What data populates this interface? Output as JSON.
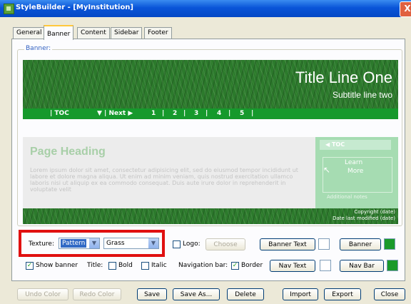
{
  "window": {
    "title": "StyleBuilder - [MyInstitution]",
    "close": "X"
  },
  "tabs": [
    "General",
    "Banner",
    "Content",
    "Sidebar",
    "Footer"
  ],
  "banner_group_label": "Banner:",
  "preview": {
    "title_line_one": "Title Line One",
    "subtitle": "Subtitle line two",
    "nav": [
      "| TOC",
      "▼ | Next ▶",
      "1",
      "|",
      "2",
      "|",
      "3",
      "|",
      "4",
      "|",
      "5",
      "|"
    ],
    "page_heading": "Page Heading",
    "body_text": "Lorem ipsum dolor sit amet, consectetur adipisicing elit, sed do eiusmod tempor incididunt ut labore et dolore magna aliqua. Ut enim ad minim veniam, quis nostrud exercitation ullamco laboris nisi ut aliquip ex ea commodo consequat. Duis aute irure dolor in reprehenderit in voluptate velit",
    "sidebar_head": "◀     TOC",
    "sidebar_learn": "Learn",
    "sidebar_more": "More",
    "sidebar_note": "Additional notes",
    "footer_copyright": "Copyright (date)",
    "footer_modified": "Date last modified (date)"
  },
  "controls": {
    "texture_label": "Texture:",
    "texture_type": "Pattern",
    "texture_name": "Grass",
    "logo_label": "Logo:",
    "choose": "Choose",
    "banner_text": "Banner Text",
    "banner": "Banner",
    "show_banner": "Show banner",
    "title_label": "Title:",
    "bold": "Bold",
    "italic": "Italic",
    "navbar_label": "Navigation bar:",
    "border": "Border",
    "nav_text": "Nav Text",
    "nav_bar": "Nav Bar",
    "check_mark": "✓"
  },
  "bottom_buttons": {
    "undo": "Undo Color",
    "redo": "Redo Color",
    "save": "Save",
    "save_as": "Save As...",
    "delete": "Delete",
    "import": "Import",
    "export": "Export",
    "close": "Close"
  },
  "colors": {
    "green_swatch": "#1a9a2a",
    "highlight": "#e01010",
    "nav_bar": "#16992c"
  }
}
